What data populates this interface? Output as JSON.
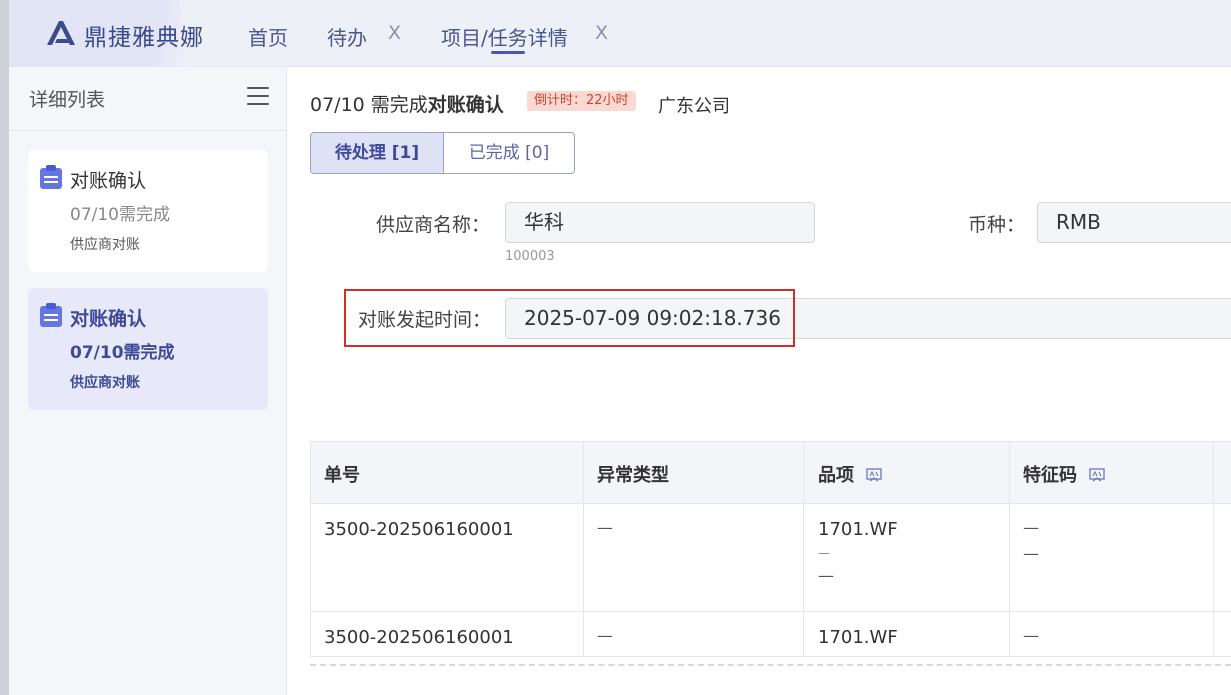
{
  "app": {
    "brand": "鼎捷雅典娜"
  },
  "nav": {
    "tabs": [
      {
        "label": "首页"
      },
      {
        "label": "待办",
        "close": "X"
      },
      {
        "label": "项目/任务详情",
        "close": "X"
      }
    ]
  },
  "sidebar": {
    "title": "详细列表",
    "cards": [
      {
        "title": "对账确认",
        "due": "07/10需完成",
        "sub": "供应商对账"
      },
      {
        "title": "对账确认",
        "due": "07/10需完成",
        "sub": "供应商对账"
      }
    ]
  },
  "detail": {
    "date_prefix": "07/10 需完成",
    "task_name": "对账确认",
    "countdown": "倒计时：22小时",
    "company": "广东公司",
    "tabs": {
      "pending": "待处理 [1]",
      "done": "已完成 [0]"
    },
    "fields": {
      "supplier_label": "供应商名称：",
      "supplier_value": "华科",
      "supplier_code": "100003",
      "currency_label": "币种：",
      "currency_value": "RMB",
      "start_time_label": "对账发起时间：",
      "start_time_value": "2025-07-09 09:02:18.736"
    }
  },
  "table": {
    "headers": [
      "单号",
      "异常类型",
      "品项",
      "特征码"
    ],
    "rows": [
      {
        "order_no": "3500-202506160001",
        "exception": "—",
        "item": "1701.WF",
        "item_extra": [
          "—",
          "—"
        ],
        "feature": "—",
        "feature_extra": "—"
      },
      {
        "order_no": "3500-202506160001",
        "exception": "—",
        "item": "1701.WF",
        "feature": "—"
      }
    ]
  },
  "colors": {
    "accent": "#3e4a99",
    "highlight": "#d62c2c",
    "countdown_bg": "#fbd9d3"
  }
}
